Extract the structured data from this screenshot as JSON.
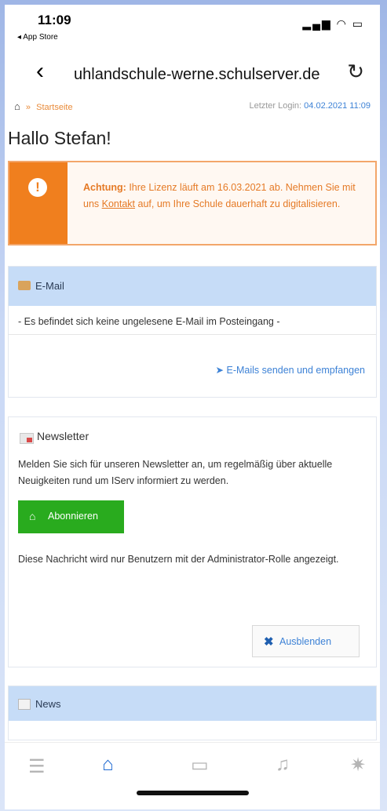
{
  "status": {
    "time": "11:09",
    "back_to": "◂ App Store"
  },
  "browser": {
    "url": "uhlandschule-werne.schulserver.de"
  },
  "breadcrumb": {
    "home": "Startseite",
    "last_login_label": "Letzter Login:",
    "last_login_value": "04.02.2021 11:09"
  },
  "greeting": "Hallo Stefan!",
  "warning": {
    "label": "Achtung:",
    "text1": " Ihre Lizenz läuft am 16.03.2021 ab. Nehmen Sie mit uns ",
    "link": "Kontakt",
    "text2": " auf, um Ihre Schule dauerhaft zu digitalisieren."
  },
  "email": {
    "title": "E-Mail",
    "message": "- Es befindet sich keine ungelesene E-Mail im Posteingang -",
    "link": "E-Mails senden und empfangen"
  },
  "newsletter": {
    "title": "Newsletter",
    "text": "Melden Sie sich für unseren Newsletter an, um regelmäßig über aktuelle Neuigkeiten rund um IServ informiert zu werden.",
    "subscribe_label": "Abonnieren",
    "note": "Diese Nachricht wird nur Benutzern mit der Administrator-Rolle angezeigt.",
    "hide_label": "Ausblenden"
  },
  "news": {
    "title": "News"
  },
  "colors": {
    "accent": "#1f6ad2",
    "warning": "#f07f1e",
    "success": "#29ab1e",
    "panel": "#c6dcf7"
  },
  "nav": [
    "menu-icon",
    "home-icon",
    "chat-icon",
    "bell-icon",
    "gear-icon"
  ]
}
